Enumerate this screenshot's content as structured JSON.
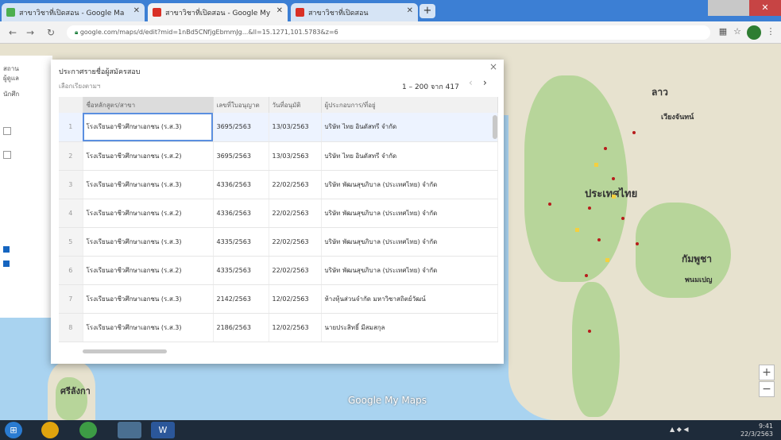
{
  "browser": {
    "tabs": [
      {
        "label": "สาขาวิชาที่เปิดสอน - Google Ma"
      },
      {
        "label": "สาขาวิชาที่เปิดสอน - Google My"
      },
      {
        "label": "สาขาวิชาที่เปิดสอน"
      }
    ],
    "new_tab": "+",
    "url": "google.com/maps/d/edit?mid=1nBd5CNfjgEbmmJg...&ll=15.1271,101.5783&z=6",
    "close": "✕"
  },
  "map": {
    "labels": [
      "ลาว",
      "เวียงจันทน์",
      "ประเทศไทย",
      "กัมพูชา",
      "พนมเปญ",
      "ศรีลังกา"
    ],
    "footer": "Google My Maps",
    "zoom_in": "+",
    "zoom_out": "−",
    "colors": {
      "water": "#a9d3f0",
      "land": "#e7e2cf",
      "pin": "#b71c1c"
    }
  },
  "left_panel": {
    "lines": [
      "สถาน",
      "ผู้ดูแล",
      "นักศึก",
      "",
      "",
      "",
      ""
    ]
  },
  "dialog": {
    "title": "ประกาศรายชื่อผู้สมัครสอบ",
    "subtitle": "เลือกเรียงตามฯ",
    "count": "1 – 200 จาก 417",
    "prev": "‹",
    "next": "›",
    "close": "×",
    "columns": [
      "",
      "ชื่อหลักสูตร/สาขา",
      "เลขที่ใบอนุญาต",
      "วันที่อนุมัติ",
      "ผู้ประกอบการ/ที่อยู่"
    ],
    "rows": [
      [
        "1",
        "โรงเรียนอาชีวศึกษาเอกชน (ร.ส.3)",
        "3695/2563",
        "13/03/2563",
        "บริษัท ไทย อินดัสทรี จำกัด"
      ],
      [
        "2",
        "โรงเรียนอาชีวศึกษาเอกชน (ร.ส.2)",
        "3695/2563",
        "13/03/2563",
        "บริษัท ไทย อินดัสทรี จำกัด"
      ],
      [
        "3",
        "โรงเรียนอาชีวศึกษาเอกชน (ร.ส.3)",
        "4336/2563",
        "22/02/2563",
        "บริษัท พัฒนสุขภิบาล (ประเทศไทย) จำกัด"
      ],
      [
        "4",
        "โรงเรียนอาชีวศึกษาเอกชน (ร.ส.2)",
        "4336/2563",
        "22/02/2563",
        "บริษัท พัฒนสุขภิบาล (ประเทศไทย) จำกัด"
      ],
      [
        "5",
        "โรงเรียนอาชีวศึกษาเอกชน (ร.ส.3)",
        "4335/2563",
        "22/02/2563",
        "บริษัท พัฒนสุขภิบาล (ประเทศไทย) จำกัด"
      ],
      [
        "6",
        "โรงเรียนอาชีวศึกษาเอกชน (ร.ส.2)",
        "4335/2563",
        "22/02/2563",
        "บริษัท พัฒนสุขภิบาล (ประเทศไทย) จำกัด"
      ],
      [
        "7",
        "โรงเรียนอาชีวศึกษาเอกชน (ร.ส.3)",
        "2142/2563",
        "12/02/2563",
        "ห้างหุ้นส่วนจำกัด มหาวิชาสถิตย์วัฒน์"
      ],
      [
        "8",
        "โรงเรียนอาชีวศึกษาเอกชน (ร.ส.3)",
        "2186/2563",
        "12/02/2563",
        "นายประสิทธิ์ มีสมสกุล"
      ]
    ]
  },
  "taskbar": {
    "start": "⊞",
    "apps": [
      "chrome",
      "qgis",
      "explorer",
      "word"
    ],
    "clock": "9:41",
    "date": "22/3/2563",
    "accent": "#1e2b3a"
  }
}
